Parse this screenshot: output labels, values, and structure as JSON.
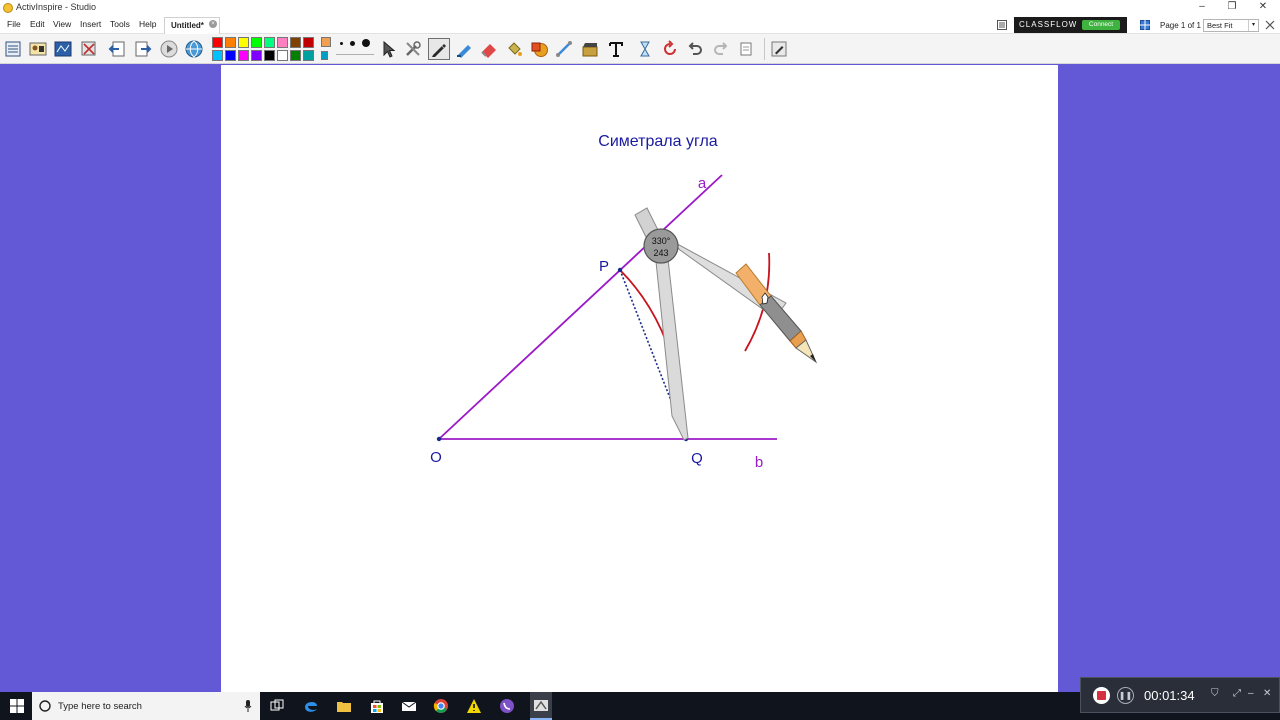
{
  "window": {
    "title": "ActivInspire - Studio",
    "controls": {
      "minimize": "–",
      "restore": "❐",
      "close": "✕"
    }
  },
  "menu": {
    "items": [
      "File",
      "Edit",
      "View",
      "Insert",
      "Tools",
      "Help"
    ],
    "document_tab": "Untitled*",
    "close_glyph": "×"
  },
  "classflow": {
    "brand": "CLASSFLOW",
    "connect": "Connect"
  },
  "page_indicator": "Page 1 of 1",
  "zoom_select": {
    "value": "Best Fit"
  },
  "palette": {
    "row1": [
      "#ff0000",
      "#ff8000",
      "#ffff00",
      "#00ff00",
      "#00ff80",
      "#ff80c0",
      "#804000",
      "#c00000"
    ],
    "row2": [
      "#00c0ff",
      "#0000ff",
      "#ff00ff",
      "#8000ff",
      "#000000",
      "#ffffff",
      "#008000",
      "#00a0a0"
    ]
  },
  "colors": {
    "background": "#6358d6",
    "canvas": "#ffffff",
    "title_text": "#1a1aa0",
    "label_text": "#1a1aa0",
    "angle_lines": "#9b19c8",
    "arc": "#c8141e",
    "dotted": "#1a2a8a"
  },
  "drawing": {
    "title": "Симетрала угла",
    "labels": {
      "a": "a",
      "b": "b",
      "O": "O",
      "P": "P",
      "Q": "Q"
    },
    "compass_readout": {
      "angle": "330°",
      "radius": "243"
    }
  },
  "taskbar": {
    "search_placeholder": "Type here to search",
    "icons": [
      "windows-start-icon",
      "task-view-icon",
      "edge-icon",
      "file-explorer-icon",
      "store-icon",
      "mail-icon",
      "chrome-icon",
      "warning-app-icon",
      "viber-icon",
      "activinspire-icon"
    ]
  },
  "recorder": {
    "elapsed": "00:01:34"
  }
}
